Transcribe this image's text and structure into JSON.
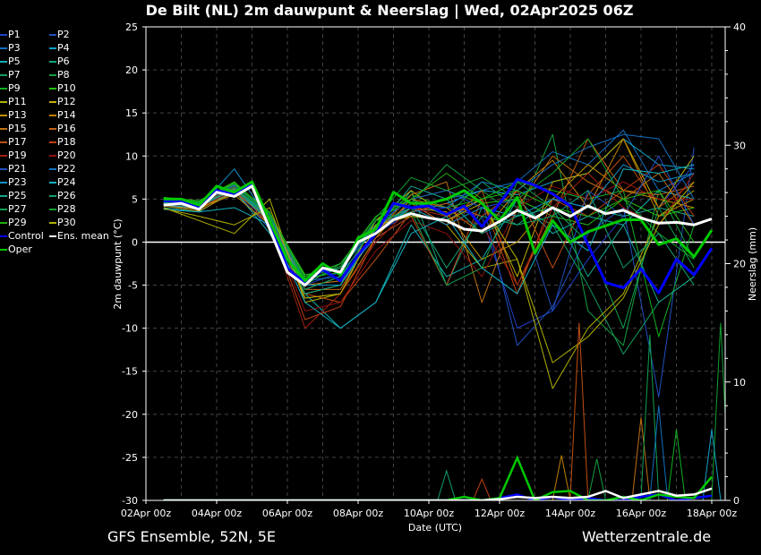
{
  "title": "De Bilt  (NL)  2m dauwpunt & Neerslag | Wed, 02Apr2025 06Z",
  "footer": {
    "left": "GFS Ensemble, 52N, 5E",
    "right": "Wetterzentrale.de"
  },
  "chart_data": {
    "type": "line",
    "title": "De Bilt  (NL)  2m dauwpunt & Neerslag | Wed, 02Apr2025 06Z",
    "xlabel": "Date (UTC)",
    "ylabel": "2m dauwpunt (°C)",
    "y2label": "Neerslag (mm)",
    "xticks": [
      "02Apr 00z",
      "04Apr 00z",
      "06Apr 00z",
      "08Apr 00z",
      "10Apr 00z",
      "12Apr 00z",
      "14Apr 00z",
      "16Apr 00z",
      "18Apr 00z"
    ],
    "ylim": [
      -30,
      25
    ],
    "yticks": [
      25,
      20,
      15,
      10,
      5,
      0,
      -5,
      -10,
      -15,
      -20,
      -25,
      -30
    ],
    "y2lim": [
      0,
      40
    ],
    "y2ticks": [
      40,
      30,
      20,
      10,
      0
    ],
    "grid": true,
    "legend_position": "left-outside",
    "x": [
      "02Apr 12z",
      "03Apr 00z",
      "03Apr 12z",
      "04Apr 00z",
      "04Apr 12z",
      "05Apr 00z",
      "05Apr 12z",
      "06Apr 00z",
      "06Apr 12z",
      "07Apr 00z",
      "07Apr 12z",
      "08Apr 00z",
      "08Apr 12z",
      "09Apr 00z",
      "09Apr 12z",
      "10Apr 00z",
      "10Apr 12z",
      "11Apr 00z",
      "11Apr 12z",
      "12Apr 00z",
      "12Apr 12z",
      "13Apr 00z",
      "13Apr 12z",
      "14Apr 00z",
      "14Apr 12z",
      "15Apr 00z",
      "15Apr 12z",
      "16Apr 00z",
      "16Apr 12z",
      "17Apr 00z",
      "17Apr 12z",
      "18Apr 00z"
    ],
    "x_members": [
      "02Apr 12z",
      "03Apr 12z",
      "04Apr 12z",
      "05Apr 12z",
      "06Apr 12z",
      "07Apr 12z",
      "08Apr 12z",
      "09Apr 12z",
      "10Apr 12z",
      "11Apr 12z",
      "12Apr 12z",
      "13Apr 12z",
      "14Apr 12z",
      "15Apr 12z",
      "16Apr 12z",
      "17Apr 12z"
    ],
    "main_series": [
      {
        "name": "Control",
        "color": "#0000ff",
        "values": [
          4.8,
          4.7,
          4.0,
          6.0,
          5.5,
          6.8,
          2.5,
          -3.0,
          -4.8,
          -3.2,
          -4.5,
          -1.5,
          1.0,
          4.5,
          4.0,
          4.2,
          3.2,
          4.2,
          1.8,
          4.5,
          7.3,
          6.6,
          5.6,
          4.2,
          -0.3,
          -4.7,
          -5.3,
          -3.1,
          -5.9,
          -2.0,
          -3.8,
          -0.7
        ],
        "precip": [
          0,
          0,
          0,
          0,
          0,
          0,
          0,
          0,
          0,
          0,
          0,
          0,
          0,
          0,
          0,
          0,
          0,
          0,
          0,
          0.2,
          0.5,
          0,
          0.3,
          0,
          0.2,
          0,
          0,
          0.3,
          0.5,
          0,
          0.2,
          0.4
        ]
      },
      {
        "name": "Oper",
        "color": "#00c800",
        "values": [
          5.0,
          5.0,
          4.3,
          6.5,
          5.8,
          7.0,
          2.5,
          -2.0,
          -4.5,
          -2.5,
          -3.8,
          0.5,
          1.5,
          5.8,
          4.5,
          4.5,
          5.0,
          6.0,
          4.5,
          2.5,
          5.2,
          -1.3,
          2.5,
          0.0,
          1.2,
          1.9,
          2.6,
          2.6,
          -0.3,
          0.4,
          -1.7,
          1.4
        ],
        "precip": [
          0,
          0,
          0,
          0,
          0,
          0,
          0,
          0,
          0,
          0,
          0,
          0,
          0,
          0,
          0,
          0,
          0,
          0.3,
          0,
          0.2,
          3.6,
          0,
          0.7,
          0.8,
          0,
          0,
          0.3,
          0,
          0.5,
          0.3,
          0.2,
          2.0
        ]
      },
      {
        "name": "Ens. mean",
        "color": "#ffffff",
        "values": [
          4.3,
          4.5,
          3.8,
          5.8,
          5.3,
          6.5,
          1.5,
          -3.5,
          -5.0,
          -3.0,
          -3.5,
          0.0,
          1.0,
          2.6,
          3.3,
          2.8,
          2.5,
          1.5,
          1.3,
          2.4,
          3.7,
          2.8,
          4.0,
          3.0,
          4.2,
          3.3,
          3.7,
          2.8,
          2.2,
          2.3,
          2.0,
          2.7
        ],
        "precip": [
          0,
          0,
          0,
          0,
          0,
          0,
          0,
          0,
          0,
          0,
          0,
          0,
          0,
          0,
          0,
          0,
          0,
          0,
          0,
          0.1,
          0.3,
          0.2,
          0.3,
          0.2,
          0.3,
          0.8,
          0.2,
          0.5,
          0.8,
          0.4,
          0.5,
          1.0
        ]
      }
    ],
    "members": [
      {
        "name": "P1",
        "color": "#2040c8",
        "values": [
          4.5,
          4.0,
          6.2,
          2.0,
          -5.0,
          -3.5,
          1.0,
          3.5,
          4.0,
          3.0,
          -10.0,
          -8.0,
          -2.0,
          3.0,
          4.0,
          9.0
        ]
      },
      {
        "name": "P2",
        "color": "#2050c0",
        "values": [
          4.6,
          4.2,
          6.0,
          1.5,
          -5.5,
          -4.0,
          0.5,
          3.0,
          2.5,
          5.0,
          -12.0,
          -7.5,
          1.0,
          4.0,
          -18.0,
          11.0
        ]
      },
      {
        "name": "P3",
        "color": "#1070c0",
        "values": [
          4.2,
          3.8,
          6.5,
          2.2,
          -4.5,
          -3.0,
          1.5,
          4.0,
          5.0,
          6.0,
          7.0,
          10.5,
          9.0,
          13.0,
          6.0,
          8.0
        ]
      },
      {
        "name": "P4",
        "color": "#10a0c8",
        "values": [
          4.4,
          4.0,
          5.8,
          3.0,
          -4.0,
          -2.5,
          2.0,
          3.5,
          4.5,
          6.0,
          5.5,
          7.0,
          8.0,
          12.0,
          9.0,
          8.5
        ]
      },
      {
        "name": "P5",
        "color": "#10b0b0",
        "values": [
          4.0,
          3.5,
          6.0,
          1.0,
          -6.0,
          -10.0,
          -7.0,
          2.0,
          -4.0,
          -2.0,
          5.0,
          1.0,
          3.0,
          2.0,
          6.0,
          5.0
        ]
      },
      {
        "name": "P6",
        "color": "#10a880",
        "values": [
          4.5,
          4.3,
          6.3,
          2.5,
          -5.0,
          -4.5,
          1.0,
          6.0,
          -5.0,
          4.0,
          2.0,
          5.0,
          4.0,
          3.0,
          4.0,
          3.0
        ]
      },
      {
        "name": "P7",
        "color": "#10a060",
        "values": [
          4.8,
          4.5,
          6.5,
          2.8,
          -4.5,
          -3.0,
          2.0,
          5.0,
          3.0,
          7.0,
          4.0,
          2.0,
          -5.0,
          -13.0,
          -7.0,
          -4.0
        ]
      },
      {
        "name": "P8",
        "color": "#10a040",
        "values": [
          5.0,
          4.6,
          6.8,
          3.5,
          -5.0,
          -2.5,
          1.5,
          4.5,
          9.0,
          6.0,
          3.0,
          12.5,
          -8.0,
          -12.0,
          6.0,
          -2.0
        ]
      },
      {
        "name": "P9",
        "color": "#10b020",
        "values": [
          4.7,
          4.4,
          6.4,
          3.0,
          -4.2,
          -3.5,
          2.5,
          5.5,
          4.0,
          5.0,
          7.0,
          6.0,
          5.0,
          6.0,
          -11.0,
          2.0
        ]
      },
      {
        "name": "P10",
        "color": "#20c010",
        "values": [
          5.2,
          4.8,
          7.0,
          3.2,
          -3.8,
          -3.0,
          2.5,
          5.0,
          6.0,
          4.5,
          5.0,
          3.0,
          2.0,
          5.0,
          3.0,
          4.0
        ]
      },
      {
        "name": "P11",
        "color": "#b0b000",
        "values": [
          4.0,
          2.5,
          1.0,
          5.0,
          -7.0,
          -6.0,
          2.0,
          4.0,
          2.0,
          -3.0,
          -2.0,
          -17.0,
          -10.0,
          -6.0,
          3.0,
          6.0
        ]
      },
      {
        "name": "P12",
        "color": "#c0b000",
        "values": [
          4.3,
          3.8,
          6.0,
          2.5,
          -6.0,
          -5.0,
          2.5,
          6.0,
          3.0,
          5.0,
          -4.0,
          7.0,
          8.0,
          12.0,
          4.0,
          10.0
        ]
      },
      {
        "name": "P13",
        "color": "#c09000",
        "values": [
          4.5,
          4.0,
          5.5,
          2.0,
          -5.5,
          -4.0,
          1.0,
          4.0,
          3.5,
          -2.0,
          0.0,
          5.0,
          9.0,
          6.0,
          5.0,
          4.0
        ]
      },
      {
        "name": "P14",
        "color": "#c08000",
        "values": [
          4.2,
          3.6,
          5.8,
          2.5,
          -6.5,
          -6.0,
          0.5,
          5.0,
          4.0,
          1.0,
          6.0,
          9.5,
          4.0,
          12.0,
          3.0,
          5.0
        ]
      },
      {
        "name": "P15",
        "color": "#c07010",
        "values": [
          4.6,
          4.2,
          6.2,
          2.8,
          -5.0,
          -4.5,
          1.0,
          5.5,
          7.0,
          -7.0,
          4.0,
          10.0,
          7.0,
          5.0,
          8.0,
          2.0
        ]
      },
      {
        "name": "P16",
        "color": "#c06010",
        "values": [
          4.4,
          3.9,
          6.0,
          3.0,
          -5.5,
          -5.5,
          1.5,
          4.5,
          2.0,
          6.0,
          -5.0,
          3.0,
          12.0,
          6.0,
          5.5,
          6.5
        ]
      },
      {
        "name": "P17",
        "color": "#c05010",
        "values": [
          4.3,
          4.1,
          5.9,
          2.6,
          -6.0,
          -7.0,
          -2.0,
          3.5,
          4.5,
          3.0,
          6.0,
          -3.0,
          5.5,
          10.0,
          4.0,
          7.0
        ]
      },
      {
        "name": "P18",
        "color": "#c04010",
        "values": [
          4.5,
          4.3,
          6.1,
          2.2,
          -9.0,
          -7.5,
          0.5,
          3.0,
          -5.0,
          5.0,
          -6.0,
          5.0,
          3.0,
          6.0,
          9.0,
          3.0
        ]
      },
      {
        "name": "P19",
        "color": "#a02010",
        "values": [
          4.6,
          4.4,
          6.4,
          2.0,
          -10.0,
          -6.0,
          0.0,
          4.0,
          3.0,
          2.0,
          -5.0,
          4.0,
          8.0,
          4.0,
          2.0,
          8.0
        ]
      },
      {
        "name": "P20",
        "color": "#901010",
        "values": [
          4.4,
          4.0,
          6.0,
          2.4,
          -8.0,
          -7.0,
          -1.0,
          2.5,
          1.0,
          -4.0,
          4.0,
          6.5,
          5.0,
          7.0,
          5.0,
          5.0
        ]
      },
      {
        "name": "P21",
        "color": "#2050c0",
        "values": [
          4.7,
          4.5,
          6.6,
          3.2,
          -4.0,
          -3.0,
          2.0,
          5.0,
          6.0,
          4.0,
          5.0,
          -8.0,
          6.0,
          3.0,
          10.0,
          2.0
        ]
      },
      {
        "name": "P22",
        "color": "#1070c0",
        "values": [
          4.5,
          4.2,
          6.3,
          2.8,
          -4.5,
          -4.0,
          1.0,
          4.5,
          4.0,
          7.0,
          6.0,
          9.0,
          11.0,
          12.5,
          12.0,
          5.0
        ]
      },
      {
        "name": "P23",
        "color": "#1090c8",
        "values": [
          4.3,
          4.0,
          8.5,
          2.5,
          -5.0,
          -5.0,
          1.0,
          4.0,
          2.0,
          4.0,
          3.0,
          5.0,
          4.0,
          9.0,
          7.0,
          8.0
        ]
      },
      {
        "name": "P24",
        "color": "#10b0c0",
        "values": [
          3.8,
          3.5,
          4.0,
          2.0,
          -7.0,
          -10.0,
          -7.0,
          1.0,
          3.0,
          -3.0,
          -6.0,
          2.0,
          -1.0,
          8.5,
          8.0,
          9.0
        ]
      },
      {
        "name": "P25",
        "color": "#10a890",
        "values": [
          4.5,
          4.1,
          6.1,
          2.4,
          -6.0,
          -5.0,
          1.5,
          6.5,
          5.0,
          1.0,
          3.0,
          4.0,
          -4.0,
          2.0,
          -7.0,
          -4.0
        ]
      },
      {
        "name": "P26",
        "color": "#10a070",
        "values": [
          4.6,
          4.3,
          6.3,
          2.6,
          -5.5,
          -4.0,
          2.0,
          4.0,
          -3.0,
          3.0,
          2.0,
          3.0,
          6.0,
          -3.0,
          1.0,
          -5.0
        ]
      },
      {
        "name": "P27",
        "color": "#10a050",
        "values": [
          4.8,
          4.6,
          6.7,
          3.0,
          -4.5,
          -3.0,
          2.5,
          3.5,
          -5.0,
          -3.0,
          7.0,
          4.0,
          0.0,
          -10.0,
          4.0,
          -3.0
        ]
      },
      {
        "name": "P28",
        "color": "#10a030",
        "values": [
          5.0,
          4.7,
          6.8,
          3.3,
          -4.2,
          -2.8,
          2.8,
          7.5,
          6.0,
          7.5,
          5.0,
          8.0,
          12.0,
          5.0,
          1.0,
          -2.0
        ]
      },
      {
        "name": "P29",
        "color": "#20b010",
        "values": [
          5.1,
          4.8,
          6.9,
          3.4,
          -4.0,
          -2.5,
          3.0,
          5.0,
          8.0,
          5.0,
          6.0,
          4.0,
          3.0,
          5.0,
          6.0,
          0.0
        ]
      },
      {
        "name": "P30",
        "color": "#b0b000",
        "values": [
          3.9,
          3.0,
          2.0,
          4.0,
          -6.5,
          -6.0,
          2.0,
          3.0,
          2.5,
          4.5,
          -2.0,
          -14.0,
          -11.0,
          -6.5,
          2.0,
          7.0
        ]
      }
    ],
    "member_precip_peaks": [
      {
        "name": "P25",
        "color": "#10a070",
        "x": "10Apr 12z",
        "mm": 2.5
      },
      {
        "name": "P18",
        "color": "#c04010",
        "x": "11Apr 12z",
        "mm": 1.8
      },
      {
        "name": "P17",
        "color": "#c05010",
        "x": "14Apr 06z",
        "mm": 15
      },
      {
        "name": "P8",
        "color": "#10a040",
        "x": "14Apr 18z",
        "mm": 3.5
      },
      {
        "name": "P14",
        "color": "#c08000",
        "x": "13Apr 18z",
        "mm": 3.8
      },
      {
        "name": "P15",
        "color": "#c07010",
        "x": "16Apr 00z",
        "mm": 7
      },
      {
        "name": "P27",
        "color": "#10a050",
        "x": "16Apr 06z",
        "mm": 14
      },
      {
        "name": "P3",
        "color": "#1070c0",
        "x": "16Apr 12z",
        "mm": 8
      },
      {
        "name": "P9",
        "color": "#10b020",
        "x": "17Apr 00z",
        "mm": 6
      },
      {
        "name": "P28",
        "color": "#10a030",
        "x": "18Apr 06z",
        "mm": 15
      },
      {
        "name": "P4",
        "color": "#10a0c8",
        "x": "18Apr 00z",
        "mm": 6
      }
    ]
  }
}
